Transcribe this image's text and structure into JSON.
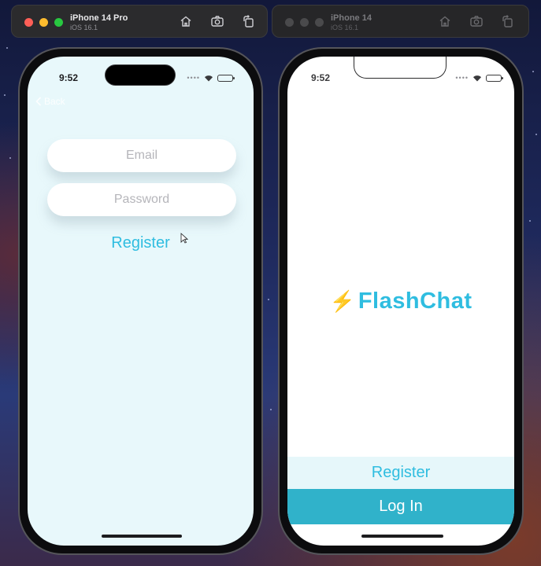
{
  "simulators": {
    "left": {
      "device_name": "iPhone 14 Pro",
      "os_version": "iOS 16.1"
    },
    "right": {
      "device_name": "iPhone 14",
      "os_version": "iOS 16.1"
    }
  },
  "left_screen": {
    "status_time": "9:52",
    "back_label": "Back",
    "email_placeholder": "Email",
    "password_placeholder": "Password",
    "register_label": "Register"
  },
  "right_screen": {
    "status_time": "9:52",
    "logo_icon": "⚡",
    "brand_title": "FlashChat",
    "register_label": "Register",
    "login_label": "Log In"
  },
  "colors": {
    "accent": "#2fbde0",
    "login_button": "#30b2ca",
    "register_bg": "#e6f7fa",
    "left_screen_bg": "#e8f8fb",
    "bolt": "#f4b400"
  }
}
